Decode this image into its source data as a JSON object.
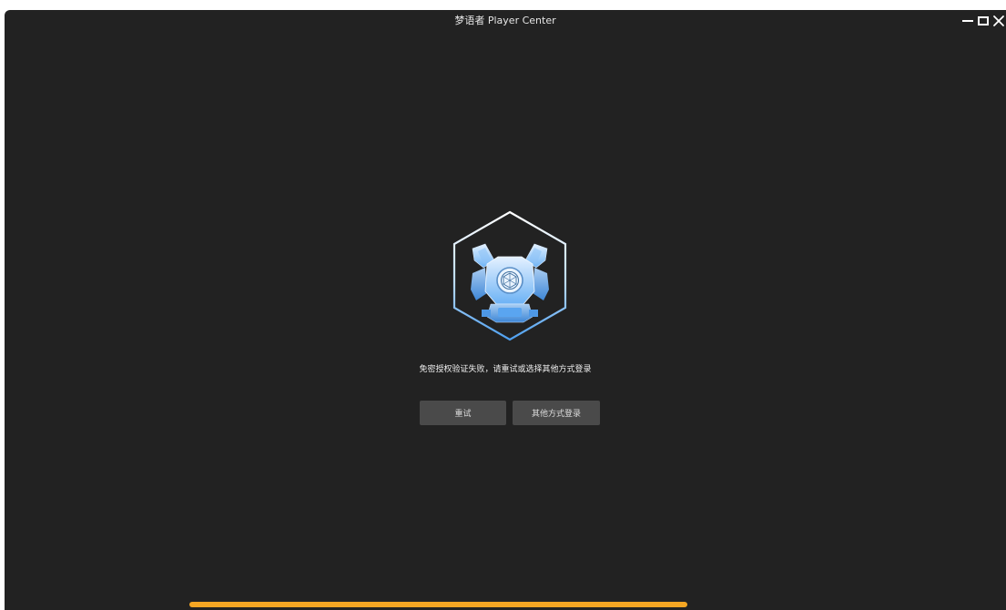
{
  "window": {
    "title": "梦语者 Player Center",
    "controls": {
      "minimize": "minimize-icon",
      "maximize": "maximize-icon",
      "close": "close-icon"
    }
  },
  "main": {
    "logo_icon": "hexagon-mech-helmet-logo",
    "message": "免密授权验证失败，请重试或选择其他方式登录",
    "buttons": {
      "retry_label": "重试",
      "other_login_label": "其他方式登录"
    }
  },
  "progress": {
    "value": 1.0,
    "color": "#f5a623"
  },
  "colors": {
    "background": "#222222",
    "button_bg": "#4a4a4a",
    "accent_blue": "#4ea0ef",
    "progress": "#f5a623"
  }
}
